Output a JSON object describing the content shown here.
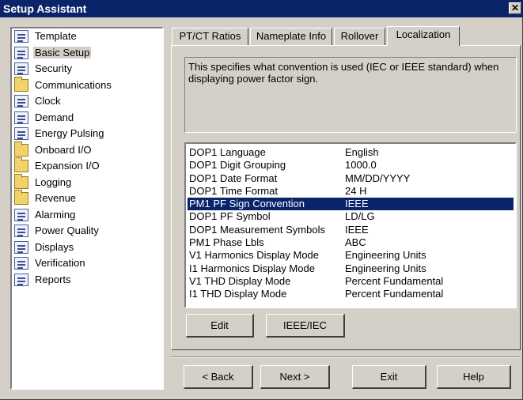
{
  "window": {
    "title": "Setup Assistant",
    "close_label": "✕"
  },
  "sidebar": {
    "items": [
      {
        "label": "Template",
        "icon": "doc"
      },
      {
        "label": "Basic Setup",
        "icon": "doc",
        "selected": true
      },
      {
        "label": "Security",
        "icon": "doc"
      },
      {
        "label": "Communications",
        "icon": "folder"
      },
      {
        "label": "Clock",
        "icon": "doc"
      },
      {
        "label": "Demand",
        "icon": "doc"
      },
      {
        "label": "Energy Pulsing",
        "icon": "doc"
      },
      {
        "label": "Onboard I/O",
        "icon": "folder"
      },
      {
        "label": "Expansion I/O",
        "icon": "folder"
      },
      {
        "label": "Logging",
        "icon": "folder"
      },
      {
        "label": "Revenue",
        "icon": "folder"
      },
      {
        "label": "Alarming",
        "icon": "doc"
      },
      {
        "label": "Power Quality",
        "icon": "doc"
      },
      {
        "label": "Displays",
        "icon": "doc"
      },
      {
        "label": "Verification",
        "icon": "doc"
      },
      {
        "label": "Reports",
        "icon": "doc"
      }
    ]
  },
  "tabs": [
    {
      "label": "PT/CT Ratios"
    },
    {
      "label": "Nameplate Info"
    },
    {
      "label": "Rollover"
    },
    {
      "label": "Localization",
      "active": true
    }
  ],
  "description": "This specifies what convention is used (IEC or IEEE standard) when displaying power factor sign.",
  "settings": [
    {
      "name": "DOP1 Language",
      "value": "English"
    },
    {
      "name": "DOP1 Digit Grouping",
      "value": "1000.0"
    },
    {
      "name": "DOP1 Date Format",
      "value": "MM/DD/YYYY"
    },
    {
      "name": "DOP1 Time Format",
      "value": "24 H"
    },
    {
      "name": "PM1 PF Sign Convention",
      "value": "IEEE",
      "selected": true
    },
    {
      "name": "DOP1 PF Symbol",
      "value": "LD/LG"
    },
    {
      "name": "DOP1 Measurement Symbols",
      "value": "IEEE"
    },
    {
      "name": "PM1 Phase Lbls",
      "value": "ABC"
    },
    {
      "name": "V1 Harmonics Display Mode",
      "value": "Engineering Units"
    },
    {
      "name": "I1 Harmonics Display Mode",
      "value": "Engineering Units"
    },
    {
      "name": "V1 THD Display Mode",
      "value": "Percent Fundamental"
    },
    {
      "name": "I1 THD Display Mode",
      "value": "Percent Fundamental"
    }
  ],
  "panel_buttons": {
    "edit": "Edit",
    "ieee_iec": "IEEE/IEC"
  },
  "footer_buttons": {
    "back": "< Back",
    "next": "Next >",
    "exit": "Exit",
    "help": "Help"
  },
  "colors": {
    "titlebar": "#0a246a",
    "selection": "#0a246a",
    "face": "#d4d0c8"
  }
}
